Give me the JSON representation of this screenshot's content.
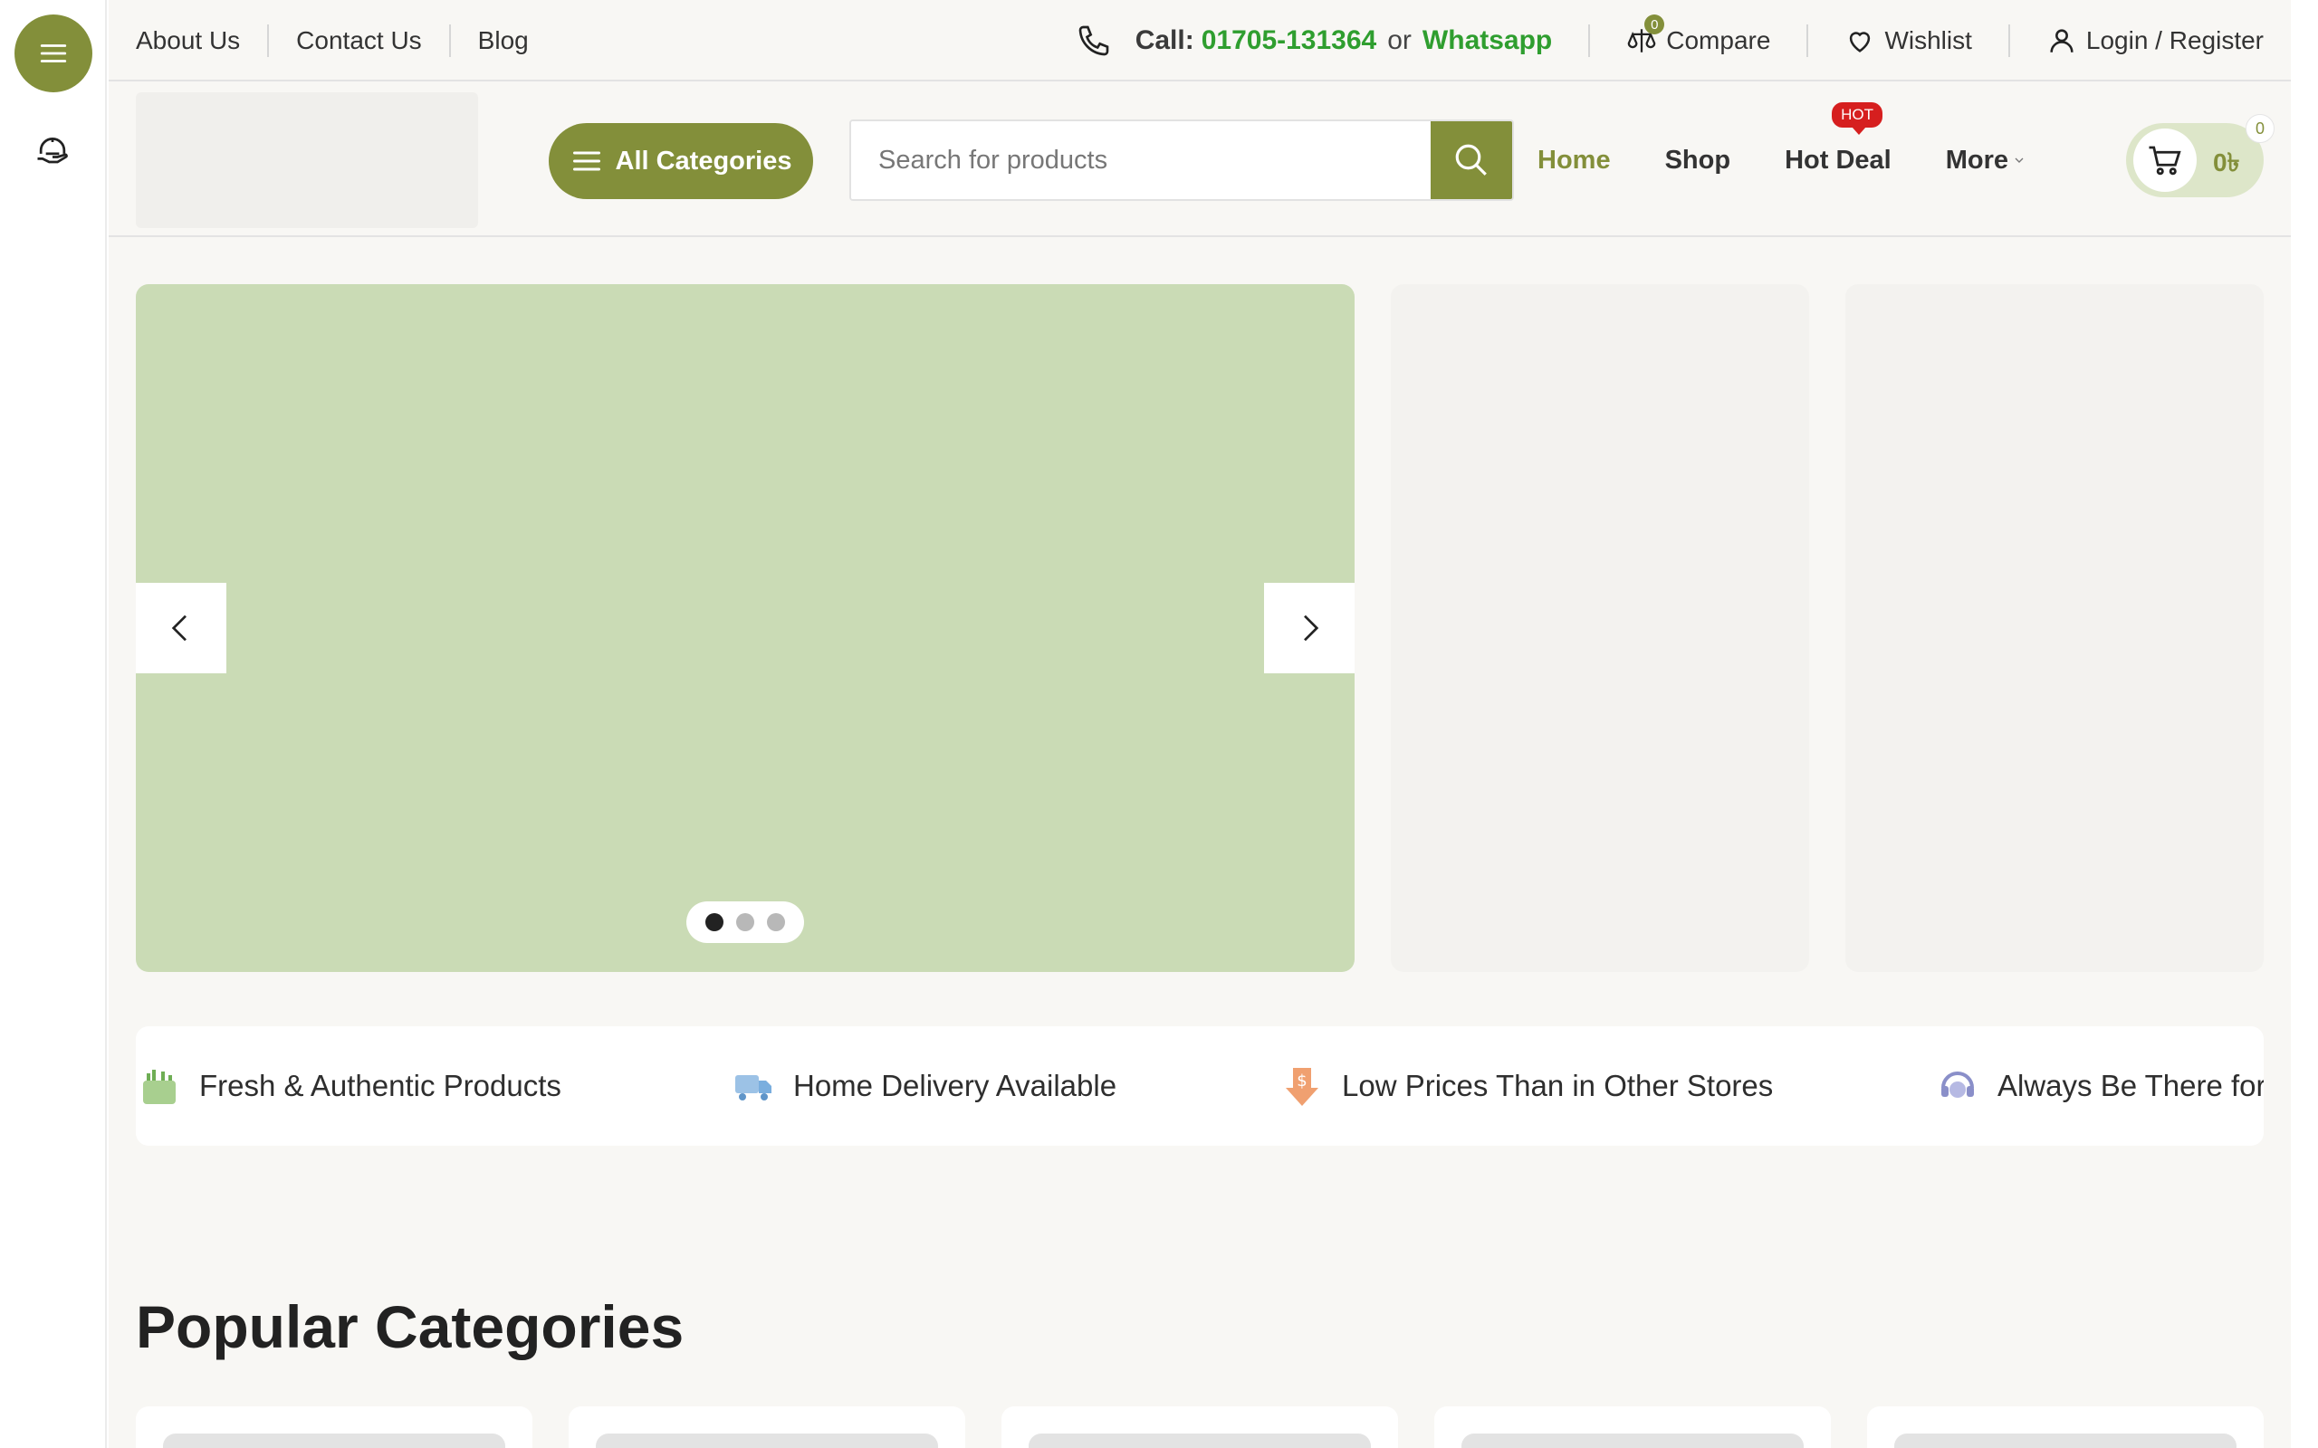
{
  "top_links": [
    "About Us",
    "Contact Us",
    "Blog"
  ],
  "call": {
    "label": "Call:",
    "number": "01705-131364",
    "or": "or",
    "whatsapp": "Whatsapp"
  },
  "compare": {
    "label": "Compare",
    "count": "0"
  },
  "wishlist": {
    "label": "Wishlist"
  },
  "login": {
    "label": "Login / Register"
  },
  "all_categories": "All Categories",
  "search": {
    "placeholder": "Search for products"
  },
  "nav": {
    "home": "Home",
    "shop": "Shop",
    "hot_deal": "Hot Deal",
    "hot_badge": "HOT",
    "more": "More"
  },
  "cart": {
    "amount": "0৳",
    "count": "0"
  },
  "carousel": {
    "slides": 3,
    "active": 1
  },
  "features": [
    "Fresh & Authentic Products",
    "Home Delivery Available",
    "Low Prices Than in Other Stores",
    "Always Be There for"
  ],
  "section_title": "Popular Categories",
  "colors": {
    "accent": "#838f3a",
    "hero_bg": "#cadbb5",
    "green_text": "#2f9e2f",
    "hot": "#d61f1f"
  }
}
